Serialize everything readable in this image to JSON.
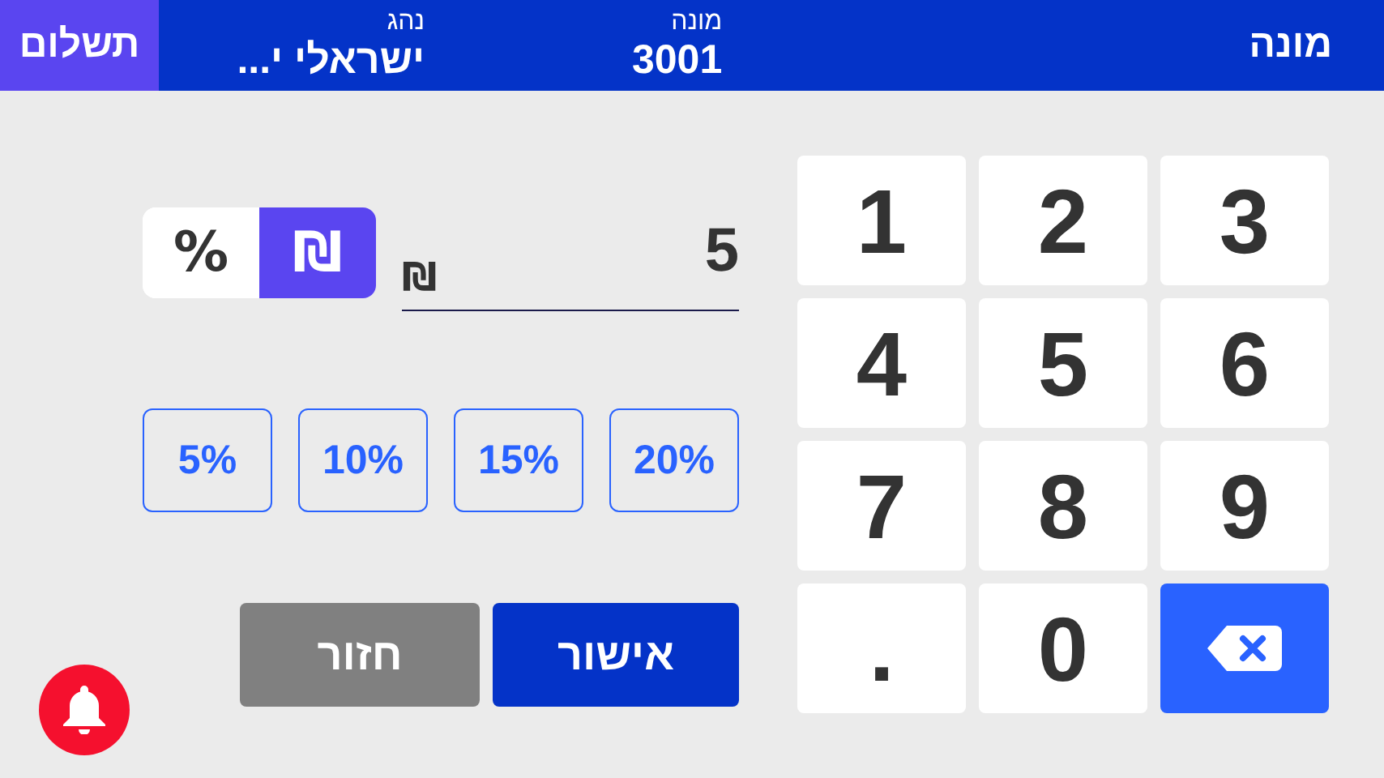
{
  "header": {
    "title": "מונה",
    "fields": [
      {
        "label": "מונה",
        "value": "3001"
      },
      {
        "label": "נהג",
        "value": "ישראלי י..."
      }
    ],
    "pay_button": "תשלום"
  },
  "unit_toggle": [
    {
      "label": "₪",
      "selected": true
    },
    {
      "label": "%",
      "selected": false
    }
  ],
  "amount": {
    "value": "5",
    "unit": "₪"
  },
  "presets": [
    "20%",
    "15%",
    "10%",
    "5%"
  ],
  "actions": [
    {
      "label": "אישור",
      "kind": "confirm"
    },
    {
      "label": "חזור",
      "kind": "back"
    }
  ],
  "keypad": [
    {
      "label": "3",
      "kind": "key"
    },
    {
      "label": "2",
      "kind": "key"
    },
    {
      "label": "1",
      "kind": "key"
    },
    {
      "label": "6",
      "kind": "key"
    },
    {
      "label": "5",
      "kind": "key"
    },
    {
      "label": "4",
      "kind": "key"
    },
    {
      "label": "9",
      "kind": "key"
    },
    {
      "label": "8",
      "kind": "key"
    },
    {
      "label": "7",
      "kind": "key"
    },
    {
      "kind": "backspace"
    },
    {
      "label": "0",
      "kind": "key"
    },
    {
      "label": ".",
      "kind": "key"
    }
  ]
}
